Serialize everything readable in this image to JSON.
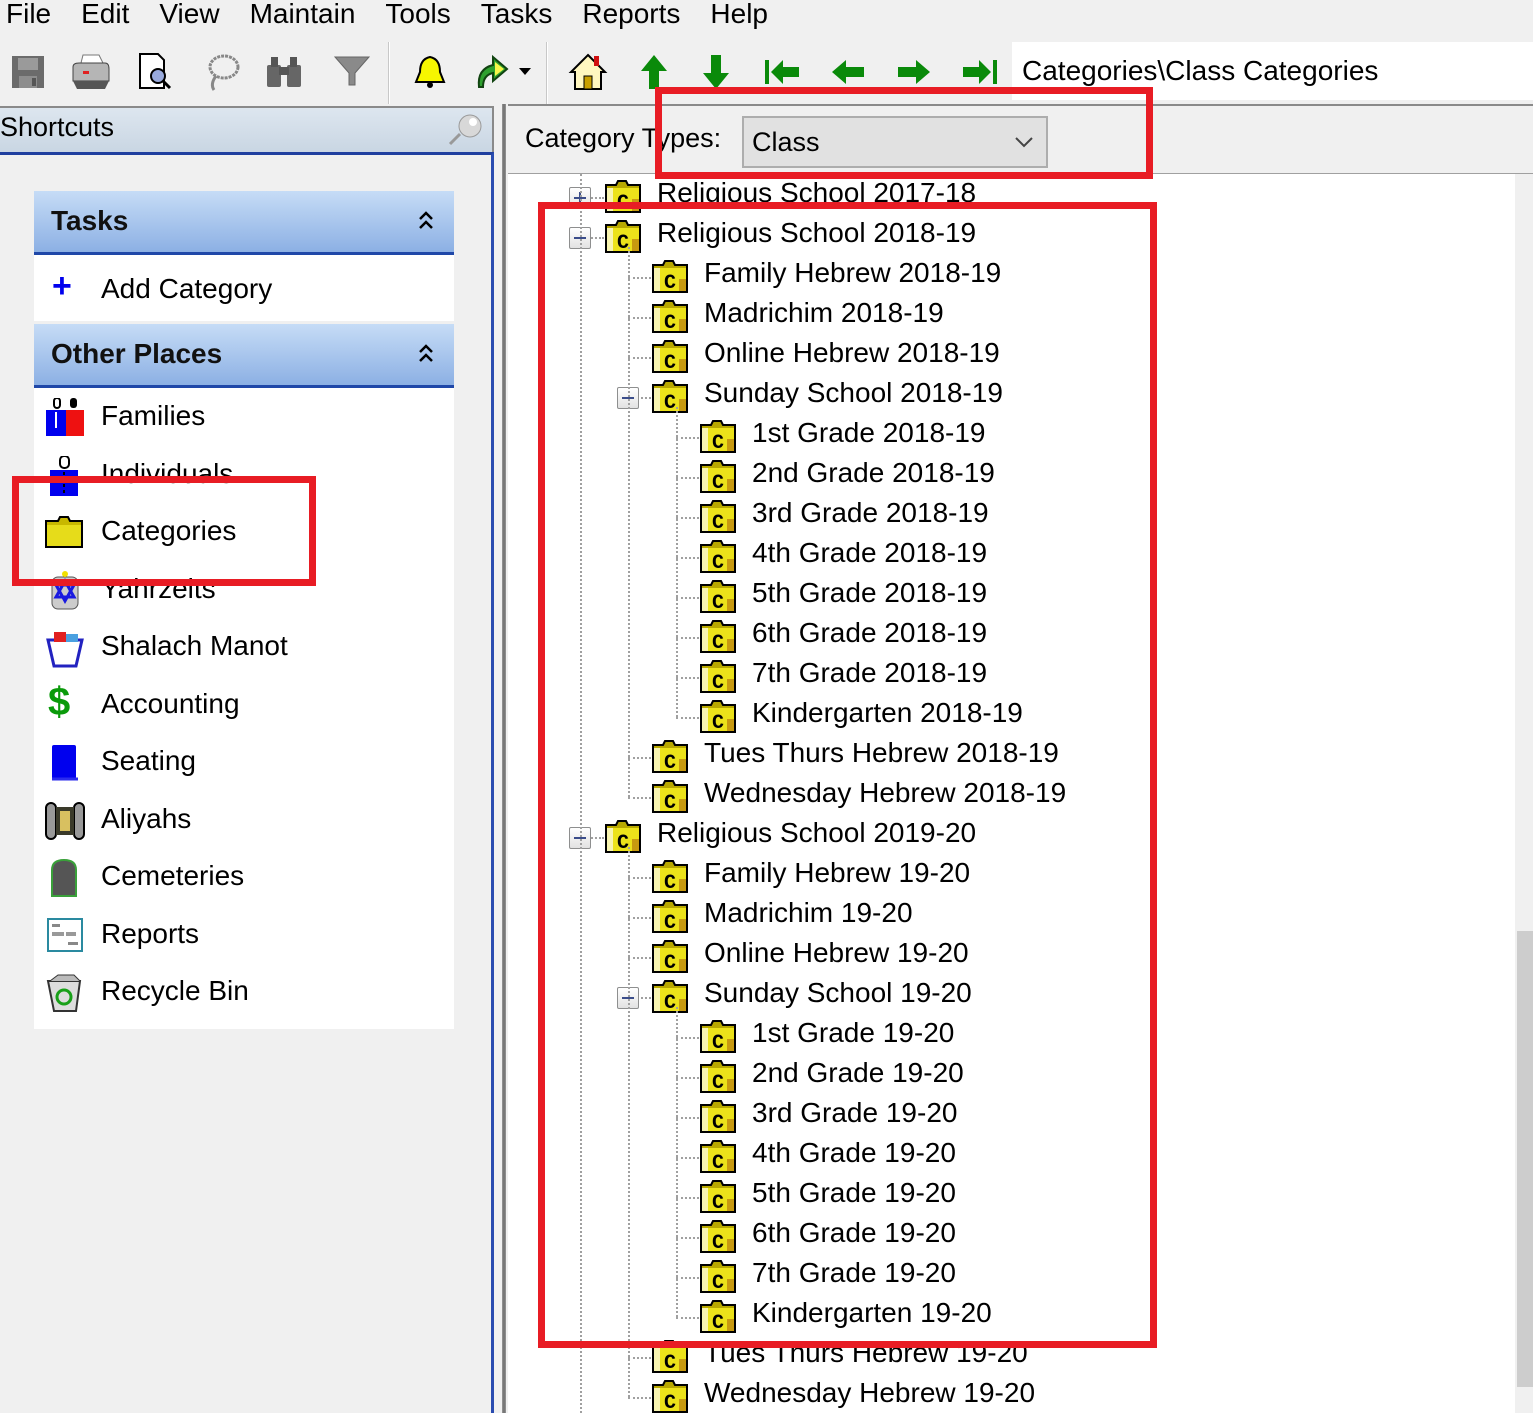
{
  "menubar": {
    "items": [
      "File",
      "Edit",
      "View",
      "Maintain",
      "Tools",
      "Tasks",
      "Reports",
      "Help"
    ]
  },
  "toolbar": {
    "buttons": [
      {
        "name": "save",
        "icon": "floppy-disk-icon"
      },
      {
        "name": "print",
        "icon": "printer-icon"
      },
      {
        "name": "print-preview",
        "icon": "print-preview-icon"
      },
      {
        "name": "lasso",
        "icon": "lasso-icon"
      },
      {
        "name": "find",
        "icon": "binoculars-icon"
      },
      {
        "name": "filter",
        "icon": "funnel-icon"
      },
      {
        "name": "reminders",
        "icon": "bell-icon"
      },
      {
        "name": "go",
        "icon": "curved-arrow-icon"
      },
      {
        "name": "home",
        "icon": "house-icon"
      },
      {
        "name": "up",
        "icon": "arrow-up-icon"
      },
      {
        "name": "down",
        "icon": "arrow-down-icon"
      },
      {
        "name": "first",
        "icon": "arrow-first-icon"
      },
      {
        "name": "previous",
        "icon": "arrow-left-icon"
      },
      {
        "name": "next",
        "icon": "arrow-right-icon"
      },
      {
        "name": "last",
        "icon": "arrow-last-icon"
      }
    ],
    "address": "Categories\\Class Categories"
  },
  "shortcuts": {
    "title": "Shortcuts",
    "tasks": {
      "title": "Tasks",
      "items": [
        {
          "label": "Add Category",
          "icon": "plus-icon"
        }
      ]
    },
    "other_places": {
      "title": "Other Places",
      "items": [
        {
          "label": "Families",
          "icon": "families-icon"
        },
        {
          "label": "Individuals",
          "icon": "individual-icon"
        },
        {
          "label": "Categories",
          "icon": "folder-icon"
        },
        {
          "label": "Yahrzeits",
          "icon": "yahrzeit-candle-icon"
        },
        {
          "label": "Shalach Manot",
          "icon": "gift-basket-icon"
        },
        {
          "label": "Accounting",
          "icon": "dollar-icon"
        },
        {
          "label": "Seating",
          "icon": "book-icon"
        },
        {
          "label": "Aliyahs",
          "icon": "torah-scroll-icon"
        },
        {
          "label": "Cemeteries",
          "icon": "tombstone-icon"
        },
        {
          "label": "Reports",
          "icon": "report-icon"
        },
        {
          "label": "Recycle Bin",
          "icon": "recycle-bin-icon"
        }
      ]
    }
  },
  "main": {
    "category_types_label": "Category Types:",
    "category_type_selected": "Class",
    "tree": [
      {
        "label": "Religious School 2017-18",
        "level": 0,
        "expander": "plus"
      },
      {
        "label": "Religious School 2018-19",
        "level": 0,
        "expander": "minus"
      },
      {
        "label": "Family Hebrew 2018-19",
        "level": 1
      },
      {
        "label": "Madrichim 2018-19",
        "level": 1
      },
      {
        "label": "Online Hebrew 2018-19",
        "level": 1
      },
      {
        "label": "Sunday School 2018-19",
        "level": 1,
        "expander": "minus"
      },
      {
        "label": "1st Grade 2018-19",
        "level": 2
      },
      {
        "label": "2nd Grade 2018-19",
        "level": 2
      },
      {
        "label": "3rd Grade 2018-19",
        "level": 2
      },
      {
        "label": "4th Grade 2018-19",
        "level": 2
      },
      {
        "label": "5th Grade 2018-19",
        "level": 2
      },
      {
        "label": "6th Grade 2018-19",
        "level": 2
      },
      {
        "label": "7th Grade 2018-19",
        "level": 2
      },
      {
        "label": "Kindergarten 2018-19",
        "level": 2
      },
      {
        "label": "Tues Thurs Hebrew 2018-19",
        "level": 1
      },
      {
        "label": "Wednesday Hebrew 2018-19",
        "level": 1
      },
      {
        "label": "Religious School 2019-20",
        "level": 0,
        "expander": "minus"
      },
      {
        "label": "Family Hebrew 19-20",
        "level": 1
      },
      {
        "label": "Madrichim 19-20",
        "level": 1
      },
      {
        "label": "Online Hebrew 19-20",
        "level": 1
      },
      {
        "label": "Sunday School 19-20",
        "level": 1,
        "expander": "minus"
      },
      {
        "label": "1st Grade 19-20",
        "level": 2
      },
      {
        "label": "2nd Grade 19-20",
        "level": 2
      },
      {
        "label": "3rd Grade 19-20",
        "level": 2
      },
      {
        "label": "4th Grade 19-20",
        "level": 2
      },
      {
        "label": "5th Grade 19-20",
        "level": 2
      },
      {
        "label": "6th Grade 19-20",
        "level": 2
      },
      {
        "label": "7th Grade 19-20",
        "level": 2
      },
      {
        "label": "Kindergarten 19-20",
        "level": 2
      },
      {
        "label": "Tues Thurs Hebrew 19-20",
        "level": 1
      },
      {
        "label": "Wednesday Hebrew 19-20",
        "level": 1
      }
    ]
  },
  "colors": {
    "annotation_red": "#e81c24",
    "group_header_top": "#c6dcf6",
    "group_header_bottom": "#8cb0e4",
    "nav_arrow_green": "#008a00",
    "folder_yellow": "#e6d800"
  }
}
